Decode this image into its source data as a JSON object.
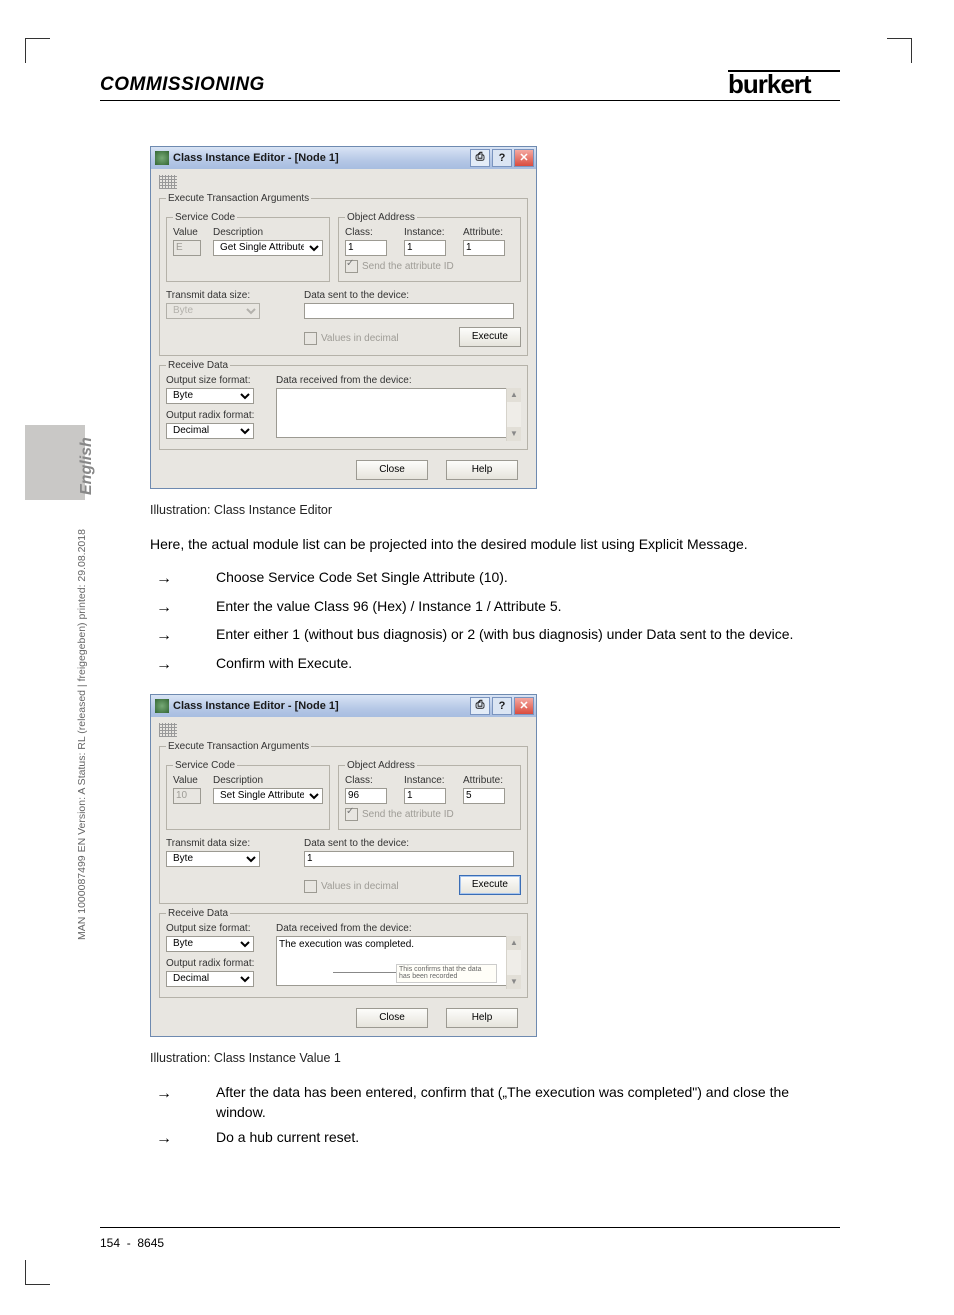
{
  "header": {
    "title": "COMMISSIONING",
    "logo": "burkert"
  },
  "side": {
    "lang": "English",
    "code": "MAN 1000087499 EN Version: A  Status: RL (released | freigegeben)  printed: 29.08.2018"
  },
  "dialog1": {
    "title": "Class Instance Editor - [Node 1]",
    "groups": {
      "execArgs": "Execute Transaction Arguments",
      "serviceCode": "Service Code",
      "objectAddress": "Object Address",
      "receiveData": "Receive Data"
    },
    "labels": {
      "value": "Value",
      "description": "Description",
      "class": "Class:",
      "instance": "Instance:",
      "attribute": "Attribute:",
      "sendAttr": "Send the attribute ID",
      "transmitSize": "Transmit data size:",
      "dataSent": "Data sent to the device:",
      "valuesDecimal": "Values in decimal",
      "outputSize": "Output size format:",
      "dataReceived": "Data received from the device:",
      "outputRadix": "Output radix format:"
    },
    "values": {
      "value": "E",
      "desc": "Get Single Attribute",
      "class": "1",
      "instance": "1",
      "attribute": "1",
      "transmit": "Byte",
      "sent": "",
      "outputSize": "Byte",
      "received": "",
      "radix": "Decimal"
    },
    "buttons": {
      "execute": "Execute",
      "close": "Close",
      "help": "Help"
    }
  },
  "caption1": "Illustration: Class Instance Editor",
  "para1": "Here, the actual module list can be projected into the desired module list using Explicit Message.",
  "steps1": [
    "Choose Service Code Set Single Attribute (10).",
    "Enter the value Class 96 (Hex) / Instance 1 / Attribute 5.",
    "Enter either 1 (without bus diagnosis) or 2 (with bus diagnosis) under Data sent to the device.",
    "Confirm with Execute."
  ],
  "dialog2": {
    "title": "Class Instance Editor - [Node 1]",
    "values": {
      "value": "10",
      "desc": "Set Single Attribute",
      "class": "96",
      "instance": "1",
      "attribute": "5",
      "transmit": "Byte",
      "sent": "1",
      "outputSize": "Byte",
      "received": "The execution was completed.",
      "radix": "Decimal"
    },
    "tip": "This confirms that the data has been recorded"
  },
  "caption2": "Illustration: Class Instance Value 1",
  "steps2": [
    "After the data has been entered, confirm that („The execution was completed\") and close the window.",
    "Do a hub current reset."
  ],
  "footer": {
    "page": "154",
    "sep": "-",
    "doc": "8645"
  }
}
